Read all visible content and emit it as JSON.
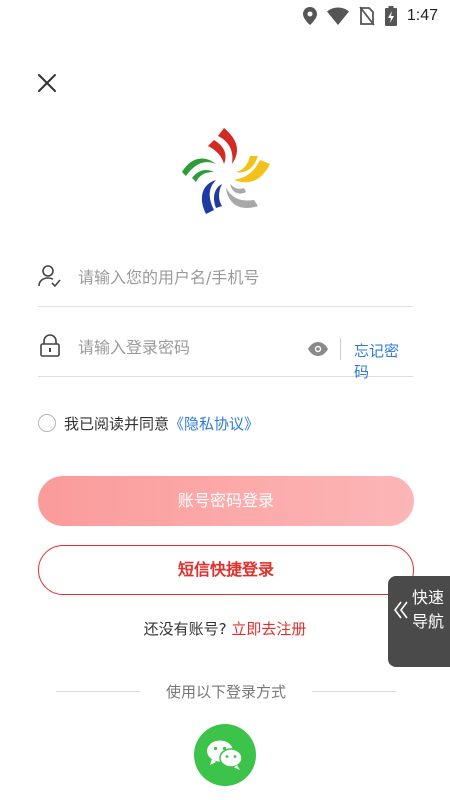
{
  "status_bar": {
    "time": "1:47",
    "icons": [
      "location-icon",
      "wifi-icon",
      "no-sim-icon",
      "battery-charging-icon"
    ]
  },
  "header": {
    "close_icon": "close-icon"
  },
  "logo": {
    "colors": [
      "#d42a24",
      "#f2c21a",
      "#1f3aa0",
      "#a8a8a8",
      "#2f9b3a"
    ]
  },
  "form": {
    "username": {
      "placeholder": "请输入您的用户名/手机号",
      "value": ""
    },
    "password": {
      "placeholder": "请输入登录密码",
      "value": ""
    },
    "forgot_label": "忘记密码"
  },
  "agreement": {
    "text": "我已阅读并同意",
    "link": "《隐私协议》",
    "checked": false
  },
  "buttons": {
    "login_label": "账号密码登录",
    "sms_label": "短信快捷登录"
  },
  "register": {
    "question": "还没有账号?",
    "link": "立即去注册"
  },
  "alt_login": {
    "label": "使用以下登录方式",
    "methods": [
      "wechat-icon"
    ]
  },
  "quick_nav": {
    "line1": "快速",
    "line2": "导航"
  },
  "colors": {
    "accent_red": "#e1302c",
    "link_blue": "#2e7bd6",
    "login_btn": "#fba5a5",
    "wechat_green": "#3cc34a"
  }
}
